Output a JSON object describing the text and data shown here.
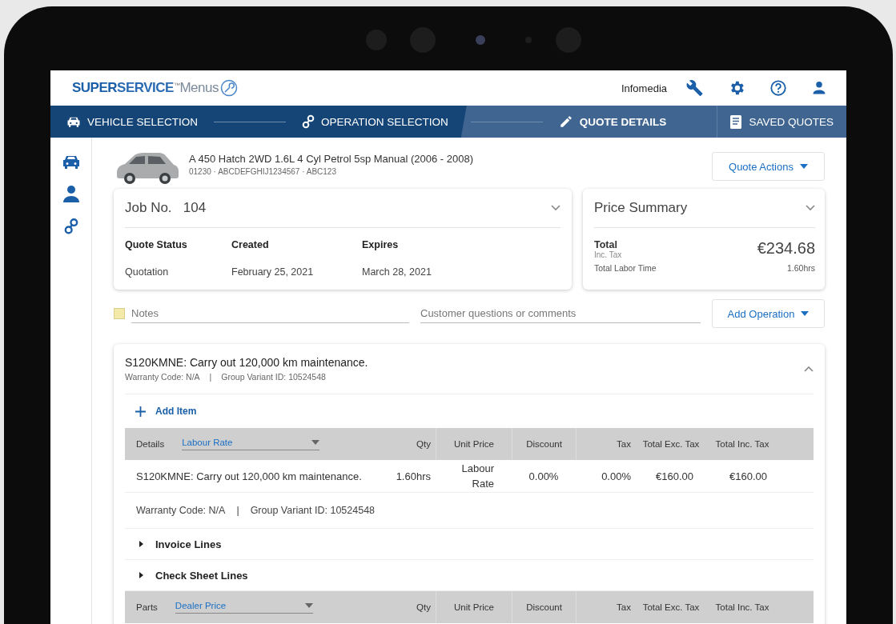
{
  "header": {
    "logo": {
      "bold": "SUPER",
      "main": "SERVICE",
      "trademark": "™",
      "product": "Menus"
    },
    "user": "Infomedia"
  },
  "steps": [
    {
      "label": "VEHICLE SELECTION",
      "selected": false
    },
    {
      "label": "OPERATION SELECTION",
      "selected": false
    },
    {
      "label": "QUOTE DETAILS",
      "selected": true
    }
  ],
  "saved_quotes": "SAVED QUOTES",
  "vehicle": {
    "title": "A 450 Hatch 2WD 1.6L 4 Cyl Petrol 5sp Manual (2006 - 2008)",
    "ids": "01230 · ABCDEFGHIJ1234567 · ABC123"
  },
  "quote_actions": "Quote Actions",
  "job": {
    "label": "Job No.",
    "number": "104",
    "fields": [
      {
        "label": "Quote Status",
        "value": "Quotation"
      },
      {
        "label": "Created",
        "value": "February 25, 2021"
      },
      {
        "label": "Expires",
        "value": "March 28, 2021"
      }
    ]
  },
  "price_summary": {
    "title": "Price Summary",
    "total_label": "Total",
    "tax_note": "Inc. Tax",
    "total": "€234.68",
    "labor_label": "Total Labor Time",
    "labor": "1.60hrs"
  },
  "notes": {
    "placeholder": "Notes"
  },
  "comments": {
    "placeholder": "Customer questions or comments"
  },
  "add_operation": "Add Operation",
  "operation": {
    "title": "S120KMNE: Carry out 120,000 km maintenance.",
    "warranty": "Warranty Code:  N/A",
    "separator": "|",
    "variant": "Group Variant ID:  10524548",
    "expanded": true,
    "add_item": "Add Item",
    "labour_table": {
      "columns": [
        "Details",
        "Qty",
        "Unit Price",
        "Discount",
        "Tax",
        "Total Exc. Tax",
        "Total Inc. Tax"
      ],
      "select": "Labour Rate",
      "rows": [
        {
          "details": "S120KMNE: Carry out 120,000 km maintenance.",
          "qty": "1.60hrs",
          "unit_price": "Labour Rate",
          "discount": "0.00%",
          "tax": "0.00%",
          "total_exc": "€160.00",
          "total_inc": "€160.00"
        }
      ]
    },
    "line_warranty": "Warranty Code: N/A",
    "line_separator": "|",
    "line_variant": "Group Variant ID: 10524548",
    "sections": [
      {
        "label": "Invoice Lines",
        "expanded": false
      },
      {
        "label": "Check Sheet Lines",
        "expanded": false
      }
    ],
    "parts_table": {
      "columns": [
        "Parts",
        "Qty",
        "Unit Price",
        "Discount",
        "Tax",
        "Total Exc. Tax",
        "Total Inc. Tax"
      ],
      "select": "Dealer Price"
    }
  }
}
